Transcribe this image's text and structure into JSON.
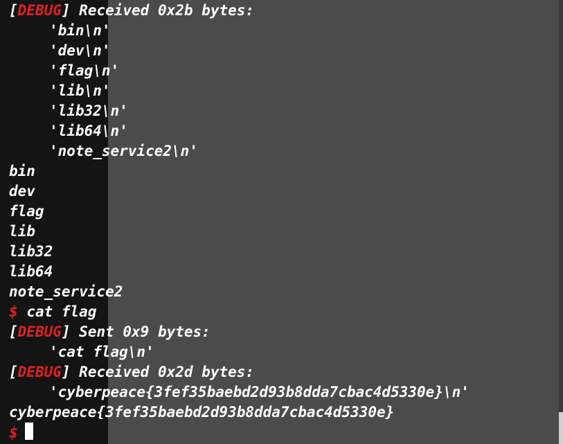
{
  "colors": {
    "text": "#ffffff",
    "debug_tag": "#e02020",
    "prompt": "#e02020",
    "background_left": "#141414",
    "background_right": "#4b4b4b"
  },
  "terminal": {
    "debug_tag": "DEBUG",
    "prompt_symbol": "$",
    "block1": {
      "header": "Received 0x2b bytes:",
      "items": [
        "'bin\\n'",
        "'dev\\n'",
        "'flag\\n'",
        "'lib\\n'",
        "'lib32\\n'",
        "'lib64\\n'",
        "'note_service2\\n'"
      ]
    },
    "ls_output": [
      "bin",
      "dev",
      "flag",
      "lib",
      "lib32",
      "lib64",
      "note_service2"
    ],
    "command": "cat flag",
    "block2": {
      "header": "Sent 0x9 bytes:",
      "item": "'cat flag\\n'"
    },
    "block3": {
      "header": "Received 0x2d bytes:",
      "item": "'cyberpeace{3fef35baebd2d93b8dda7cbac4d5330e}\\n'"
    },
    "flag_output": "cyberpeace{3fef35baebd2d93b8dda7cbac4d5330e}"
  }
}
